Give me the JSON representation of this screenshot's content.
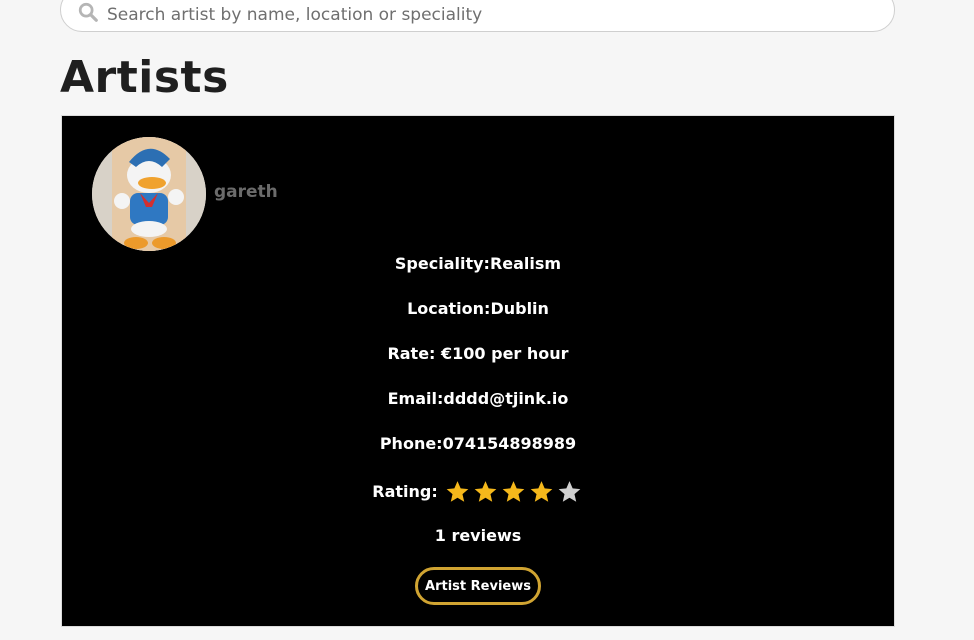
{
  "search": {
    "placeholder": "Search artist by name, location or speciality",
    "icon": "search-icon"
  },
  "page": {
    "title": "Artists"
  },
  "artist": {
    "name": "gareth",
    "avatar_icon": "avatar",
    "speciality": "Speciality:Realism",
    "location": "Location:Dublin",
    "rate": "Rate: €100 per hour",
    "email": "Email:dddd@tjink.io",
    "phone": "Phone:074154898989",
    "rating_label": "Rating:",
    "rating_value": 4,
    "rating_max": 5,
    "reviews_count": "1 reviews",
    "reviews_button_label": "Artist Reviews"
  },
  "colors": {
    "card_background": "#000000",
    "star_filled": "#f5b81b",
    "star_empty": "#cfcfcf",
    "button_border": "#d0a432",
    "page_background": "#f6f6f6"
  }
}
